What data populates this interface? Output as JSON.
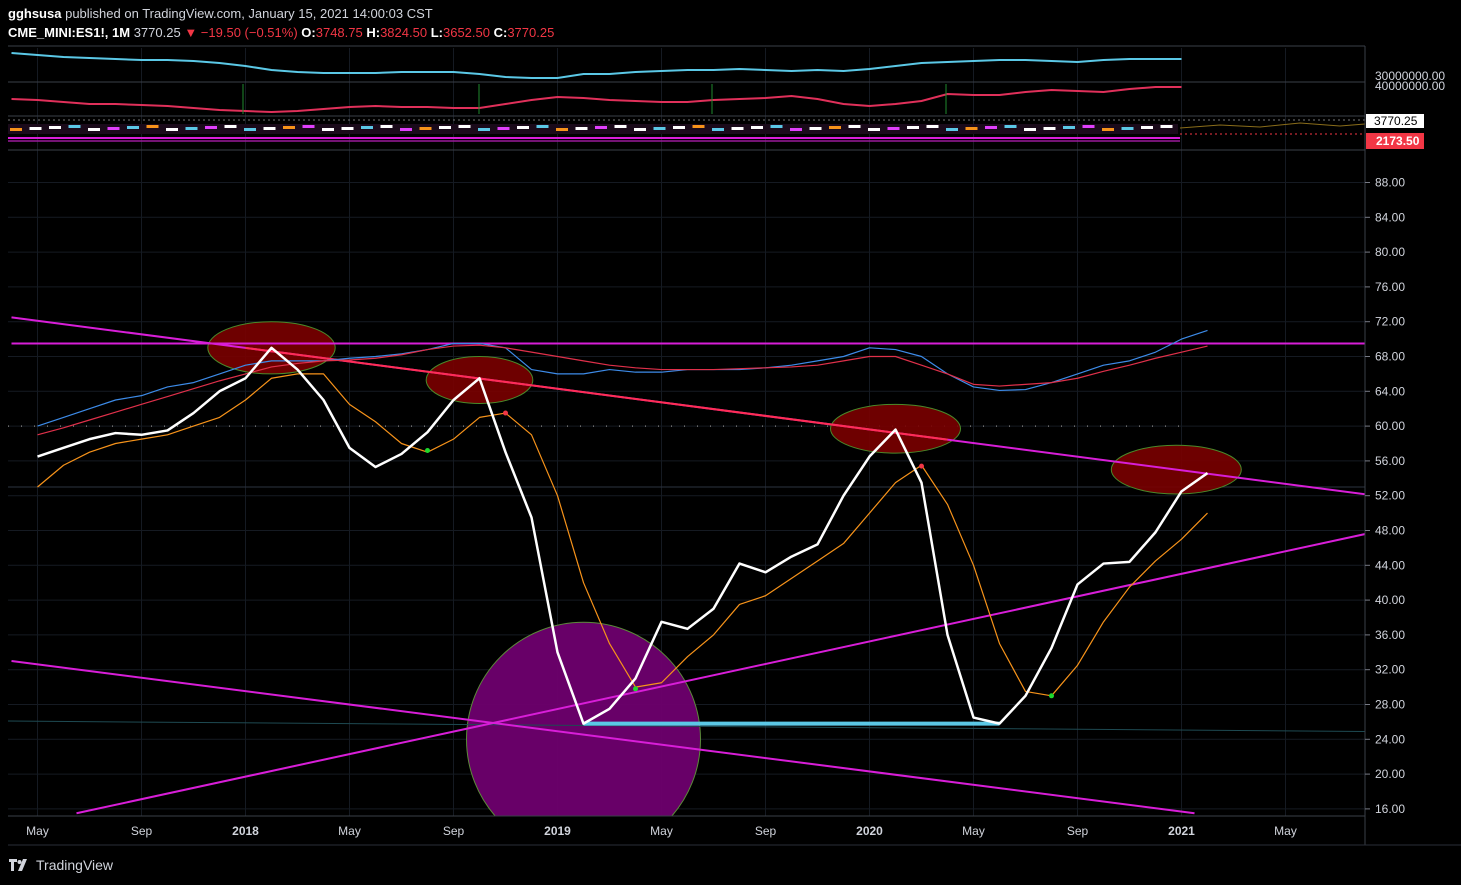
{
  "header": {
    "author": "gghsusa",
    "published_text": "published on TradingView.com, January 15, 2021 14:00:03 CST",
    "symbol": "CME_MINI:ES1!, 1M",
    "last": "3770.25",
    "change": "▼ −19.50 (−0.51%)",
    "open_label": "O:",
    "open": "3748.75",
    "high_label": "H:",
    "high": "3824.50",
    "low_label": "L:",
    "low": "3652.50",
    "close_label": "C:",
    "close": "3770.25"
  },
  "footer": {
    "brand": "TradingView"
  },
  "colors": {
    "background": "#000000",
    "volume_line": "#5bc8e6",
    "red_line": "#e0305a",
    "magenta": "#d81ed8",
    "main_line": "#ffffff",
    "orange_line": "#f7931a",
    "blue_line": "#3d8be8",
    "red_ma": "#e0304a",
    "ellipse_fill": "#7a0000",
    "circle_fill": "#6e006e",
    "support_line": "#5bc8e6",
    "price_badge_red": "#f23645"
  },
  "chart_data": {
    "type": "line",
    "x_axis_labels": [
      "May",
      "Sep",
      "2018",
      "May",
      "Sep",
      "2019",
      "May",
      "Sep",
      "2020",
      "May",
      "Sep",
      "2021",
      "May"
    ],
    "y_axis": {
      "ticks": [
        "88.00",
        "84.00",
        "80.00",
        "76.00",
        "72.00",
        "68.00",
        "64.00",
        "60.00",
        "56.00",
        "52.00",
        "48.00",
        "44.00",
        "40.00",
        "36.00",
        "32.00",
        "28.00",
        "24.00",
        "20.00",
        "16.00"
      ],
      "ylim": [
        15,
        92
      ]
    },
    "top_panel_labels": [
      "30000000.00",
      "40000000.00"
    ],
    "price_labels": [
      "3770.25",
      "2173.50"
    ],
    "x_months": [
      0,
      1,
      2,
      3,
      4,
      5,
      6,
      7,
      8,
      9,
      10,
      11,
      12,
      13,
      14,
      15,
      16,
      17,
      18,
      19,
      20,
      21,
      22,
      23,
      24,
      25,
      26,
      27,
      28,
      29,
      30,
      31,
      32,
      33,
      34,
      35,
      36,
      37,
      38,
      39,
      40,
      41,
      42,
      43,
      44,
      45
    ],
    "series": [
      {
        "key": "main",
        "values": [
          56.5,
          57.5,
          58.5,
          59.2,
          59,
          59.5,
          61.5,
          64,
          65.5,
          69,
          66.5,
          63,
          57.5,
          55.3,
          56.8,
          59.3,
          63,
          65.5,
          57,
          49.5,
          34,
          25.8,
          27.5,
          31,
          37.5,
          36.7,
          39,
          44.2,
          43.2,
          45,
          46.4,
          52,
          56.5,
          59.6,
          53.5,
          36,
          26.5,
          25.8,
          29,
          34.5,
          41.8,
          44.2,
          44.4,
          47.8,
          52.5,
          54.6
        ]
      },
      {
        "key": "orange",
        "values": [
          53,
          55.5,
          57,
          58,
          58.5,
          59,
          60,
          61,
          63,
          65.5,
          66,
          66,
          62.5,
          60.5,
          58,
          57,
          58.5,
          61,
          61.5,
          59,
          52,
          42,
          35,
          30,
          30.5,
          33.5,
          36,
          39.5,
          40.5,
          42.5,
          44.5,
          46.5,
          50,
          53.5,
          55.5,
          51,
          44,
          35,
          29.5,
          29,
          32.5,
          37.5,
          41.5,
          44.5,
          47,
          50
        ]
      },
      {
        "key": "blue",
        "values": [
          60,
          61,
          62,
          63,
          63.5,
          64.5,
          65,
          66,
          67,
          67.5,
          67.5,
          67.5,
          67.8,
          68,
          68.3,
          68.8,
          69.5,
          69.5,
          69,
          66.5,
          66,
          66,
          66.5,
          66.2,
          66.2,
          66.5,
          66.5,
          66.5,
          66.7,
          67,
          67.5,
          68,
          69,
          68.8,
          68,
          66,
          64.5,
          64.1,
          64.2,
          65,
          66,
          67,
          67.5,
          68.5,
          70,
          71
        ]
      },
      {
        "key": "red_ma",
        "values": [
          59,
          59.8,
          60.7,
          61.6,
          62.5,
          63.4,
          64.3,
          65.2,
          66,
          66.8,
          67.2,
          67.5,
          67.6,
          67.8,
          68.2,
          68.8,
          69.2,
          69.3,
          69,
          68.5,
          68,
          67.5,
          67,
          66.7,
          66.5,
          66.5,
          66.5,
          66.6,
          66.7,
          66.8,
          67,
          67.5,
          68,
          68,
          67,
          66,
          64.8,
          64.6,
          64.8,
          65,
          65.5,
          66.3,
          67,
          67.8,
          68.5,
          69.2
        ]
      }
    ],
    "markers": [
      {
        "x": 15,
        "y": 57.2,
        "color": "#1fd82c"
      },
      {
        "x": 18,
        "y": 61.5,
        "color": "#f23645"
      },
      {
        "x": 23,
        "y": 29.8,
        "color": "#1fd82c"
      },
      {
        "x": 34,
        "y": 55.4,
        "color": "#f23645"
      },
      {
        "x": 39,
        "y": 29.0,
        "color": "#1fd82c"
      }
    ],
    "trendlines": [
      {
        "name": "resistance",
        "x": [
          -1,
          52
        ],
        "y": [
          72.5,
          51.8
        ]
      },
      {
        "name": "horizontal",
        "x": [
          -1,
          52
        ],
        "y": [
          69.5,
          69.5
        ]
      },
      {
        "name": "rising",
        "x": [
          1.5,
          52
        ],
        "y": [
          15.5,
          48.2
        ]
      },
      {
        "name": "falling",
        "x": [
          -1,
          44.5
        ],
        "y": [
          33,
          15.5
        ]
      }
    ],
    "support": {
      "x": [
        21,
        37
      ],
      "y": 25.8
    },
    "dotted_level": 60,
    "gray_level": 53,
    "ellipses": [
      {
        "x": 9,
        "y": 69,
        "rx": 2.45,
        "ry": 3.0
      },
      {
        "x": 17,
        "y": 65.3,
        "rx": 2.05,
        "ry": 2.7
      },
      {
        "x": 33,
        "y": 59.7,
        "rx": 2.5,
        "ry": 2.8
      },
      {
        "x": 43.8,
        "y": 55,
        "rx": 2.5,
        "ry": 2.8
      }
    ],
    "circle": {
      "x": 21,
      "y": 24,
      "r_months": 4.5
    }
  }
}
